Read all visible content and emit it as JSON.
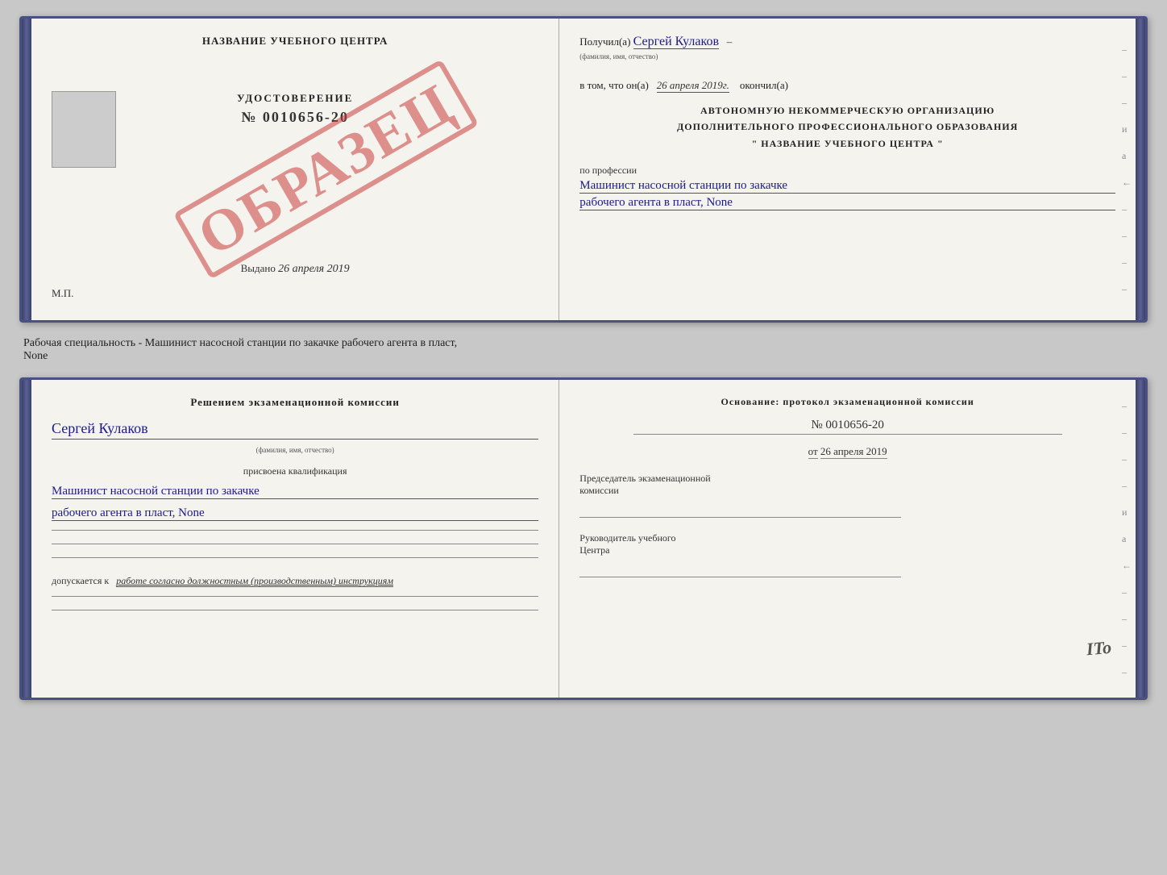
{
  "topDoc": {
    "leftPanel": {
      "title": "НАЗВАНИЕ УЧЕБНОГО ЦЕНТРА",
      "certLabel": "УДОСТОВЕРЕНИЕ",
      "certNumber": "№ 0010656-20",
      "issuedPrefix": "Выдано",
      "issuedDate": "26 апреля 2019",
      "mpLabel": "М.П.",
      "watermark": "ОБРАЗЕЦ"
    },
    "rightPanel": {
      "receivedLabel": "Получил(а)",
      "receivedName": "Сергей Кулаков",
      "nameHint": "(фамилия, имя, отчество)",
      "dateLabel": "в том, что он(а)",
      "date": "26 апреля 2019г.",
      "dateEnding": "окончил(а)",
      "orgLine1": "АВТОНОМНУЮ НЕКОММЕРЧЕСКУЮ ОРГАНИЗАЦИЮ",
      "orgLine2": "ДОПОЛНИТЕЛЬНОГО ПРОФЕССИОНАЛЬНОГО ОБРАЗОВАНИЯ",
      "orgLine3": "\"   НАЗВАНИЕ УЧЕБНОГО ЦЕНТРА   \"",
      "professionLabel": "по профессии",
      "professionLine1": "Машинист насосной станции по закачке",
      "professionLine2": "рабочего агента в пласт, None"
    }
  },
  "specialtyText": "Рабочая специальность - Машинист насосной станции по закачке рабочего агента в пласт,\nNone",
  "bottomDoc": {
    "leftPanel": {
      "commissionTitle": "Решением  экзаменационной  комиссии",
      "personName": "Сергей Кулаков",
      "nameHint": "(фамилия, имя, отчество)",
      "qualificationLabel": "присвоена квалификация",
      "qualificationLine1": "Машинист насосной станции по закачке",
      "qualificationLine2": "рабочего агента в пласт, None",
      "admittedText": "допускается к",
      "admittedWorkText": "работе согласно должностным (производственным) инструкциям"
    },
    "rightPanel": {
      "basisTitle": "Основание:  протокол  экзаменационной  комиссии",
      "protocolNumber": "№  0010656-20",
      "datePrefix": "от",
      "date": "26 апреля 2019",
      "chairmanLine1": "Председатель экзаменационной",
      "chairmanLine2": "комиссии",
      "headLine1": "Руководитель учебного",
      "headLine2": "Центра"
    }
  },
  "itoMark": "ITo"
}
